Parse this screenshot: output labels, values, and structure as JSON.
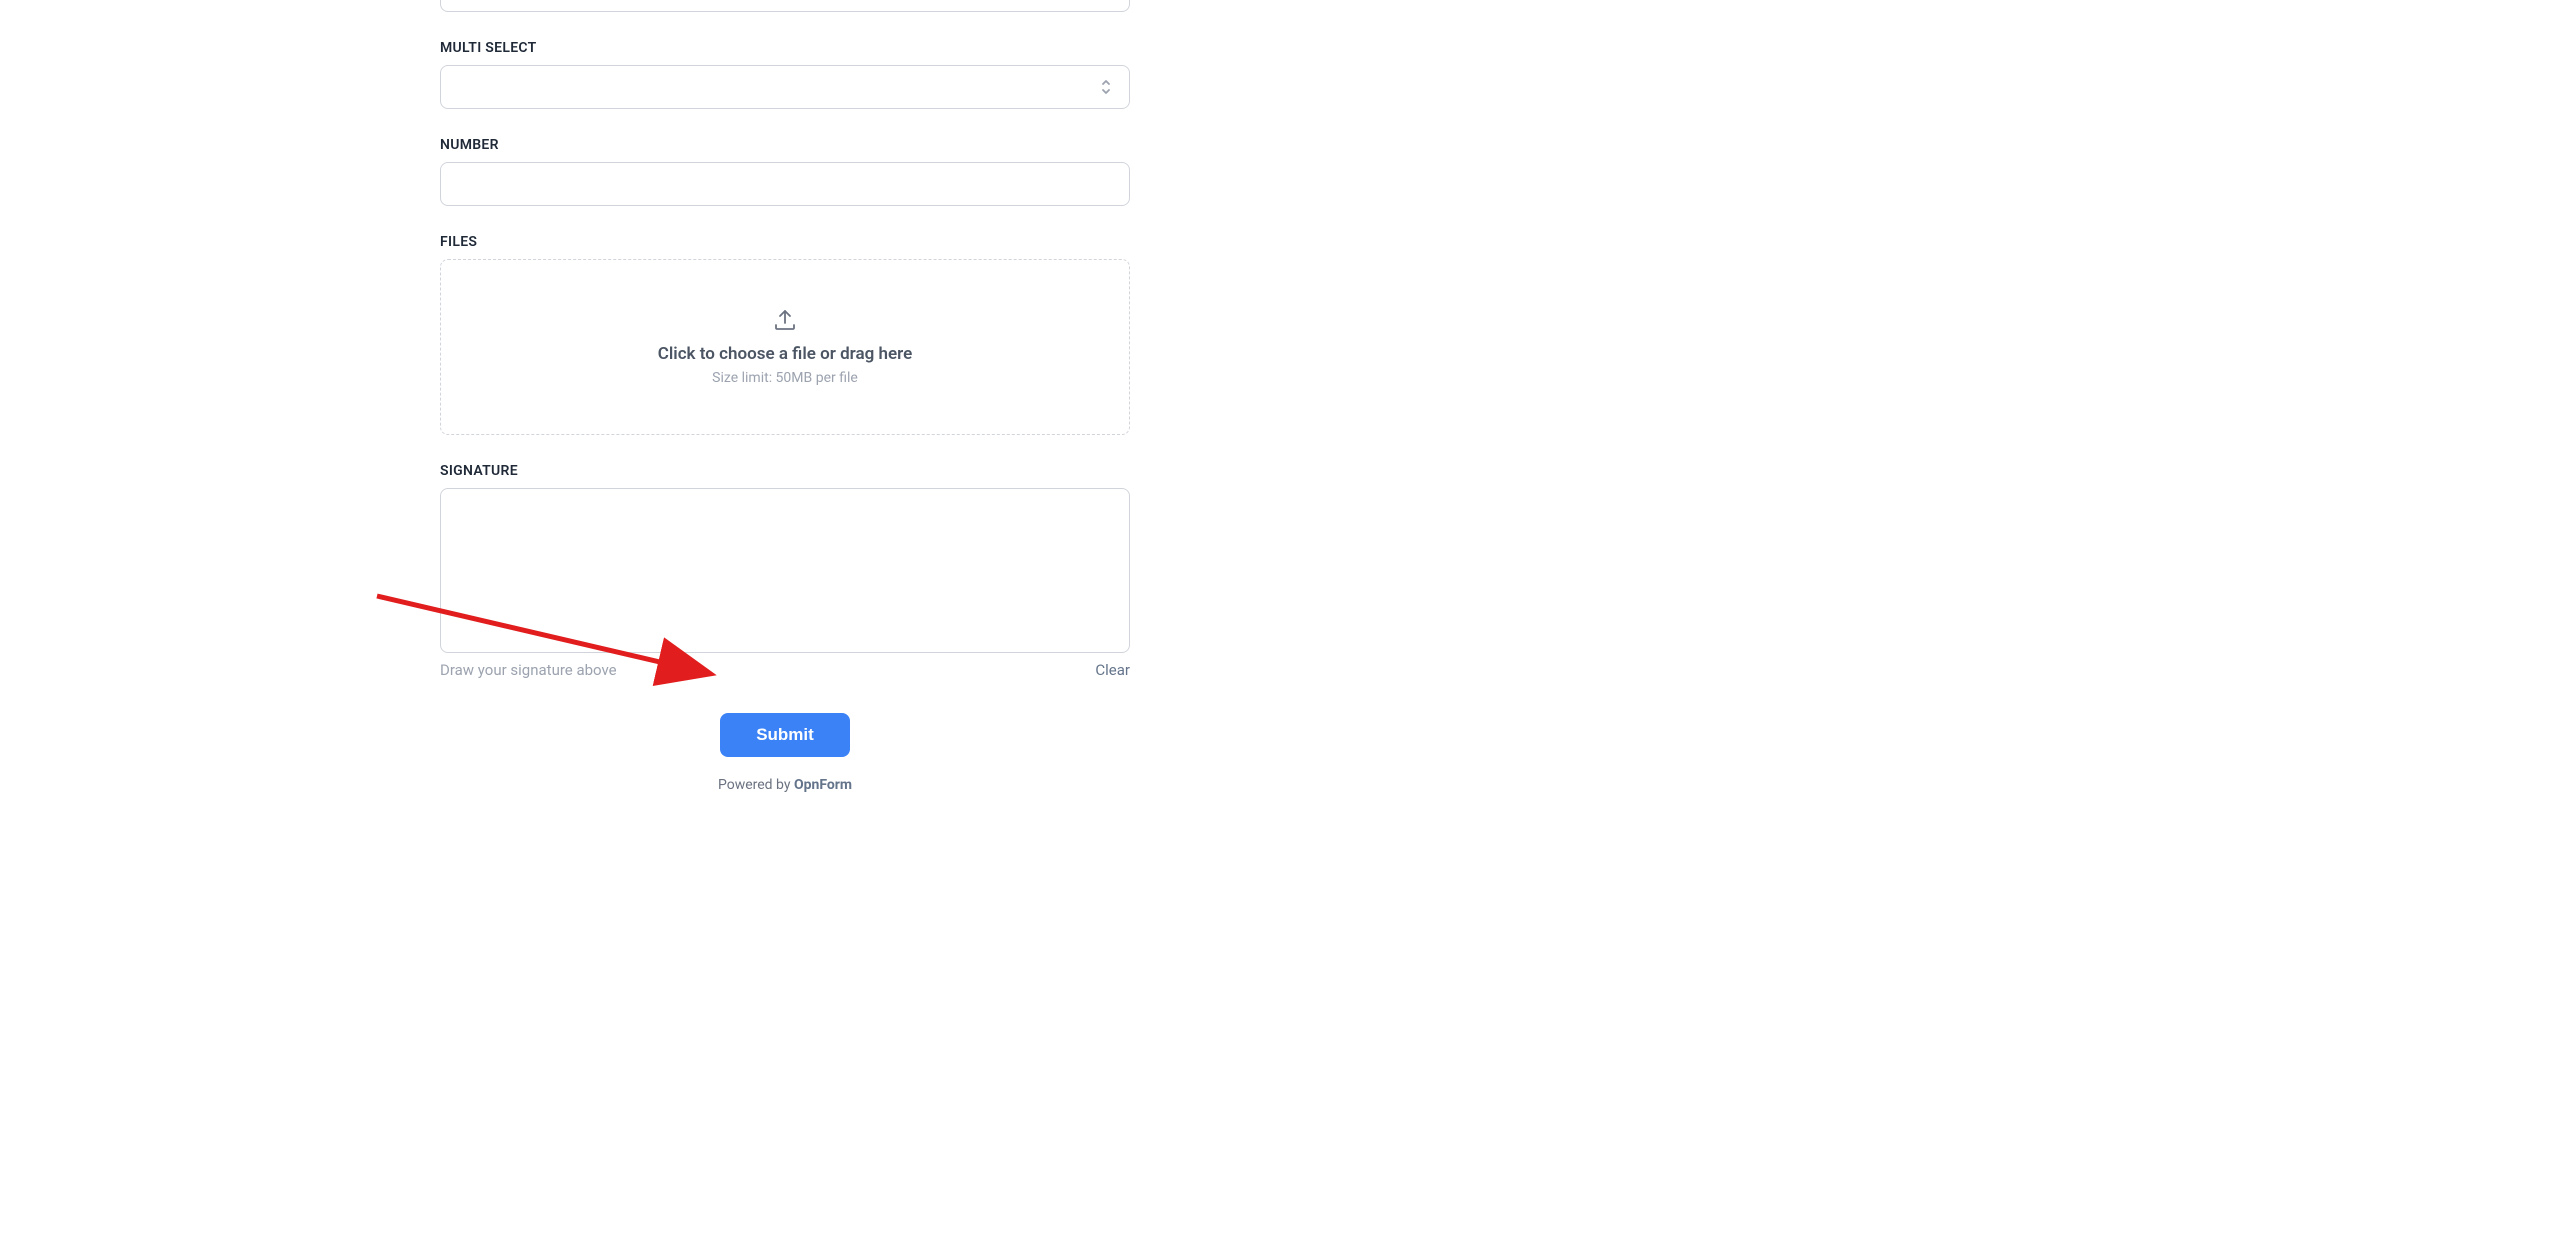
{
  "form": {
    "multi_select": {
      "label": "MULTI SELECT"
    },
    "number": {
      "label": "NUMBER"
    },
    "files": {
      "label": "FILES",
      "upload_text": "Click to choose a file or drag here",
      "upload_subtext": "Size limit: 50MB per file"
    },
    "signature": {
      "label": "SIGNATURE",
      "hint": "Draw your signature above",
      "clear_label": "Clear"
    },
    "submit": {
      "label": "Submit"
    },
    "footer": {
      "powered_by": "Powered by ",
      "brand": "OpnForm"
    }
  }
}
